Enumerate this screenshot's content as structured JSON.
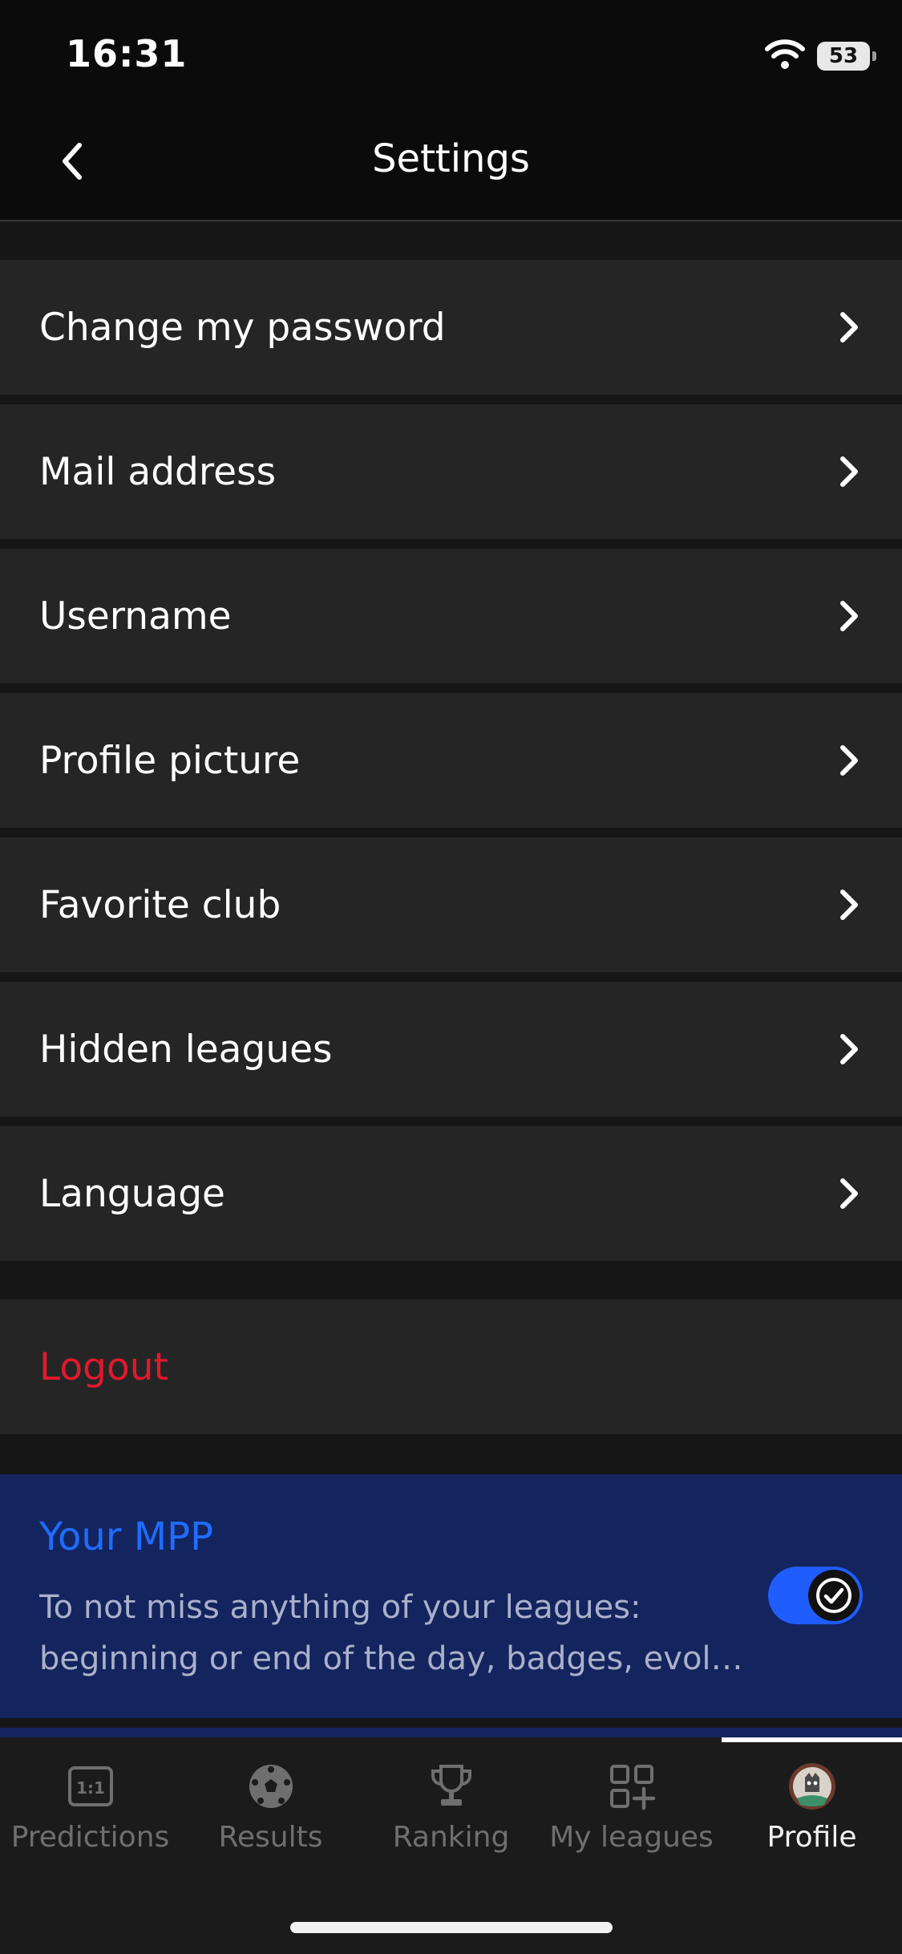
{
  "status": {
    "time": "16:31",
    "battery": "53"
  },
  "header": {
    "title": "Settings",
    "back_icon": "chevron-left-icon"
  },
  "menu": [
    {
      "label": "Change my password"
    },
    {
      "label": "Mail address"
    },
    {
      "label": "Username"
    },
    {
      "label": "Profile picture"
    },
    {
      "label": "Favorite club"
    },
    {
      "label": "Hidden leagues"
    },
    {
      "label": "Language"
    }
  ],
  "logout": {
    "label": "Logout",
    "color": "#e0192e"
  },
  "mpp": {
    "title": "Your MPP",
    "line1": "To not miss anything of your leagues:",
    "line2": "beginning or end of the day, badges, evoluti…",
    "toggle_on": true,
    "accent": "#1f6cff"
  },
  "tabs": [
    {
      "label": "Predictions",
      "icon": "scoreboard-icon"
    },
    {
      "label": "Results",
      "icon": "football-icon"
    },
    {
      "label": "Ranking",
      "icon": "trophy-icon"
    },
    {
      "label": "My leagues",
      "icon": "grid-plus-icon"
    },
    {
      "label": "Profile",
      "icon": "avatar-icon",
      "active": true
    }
  ]
}
